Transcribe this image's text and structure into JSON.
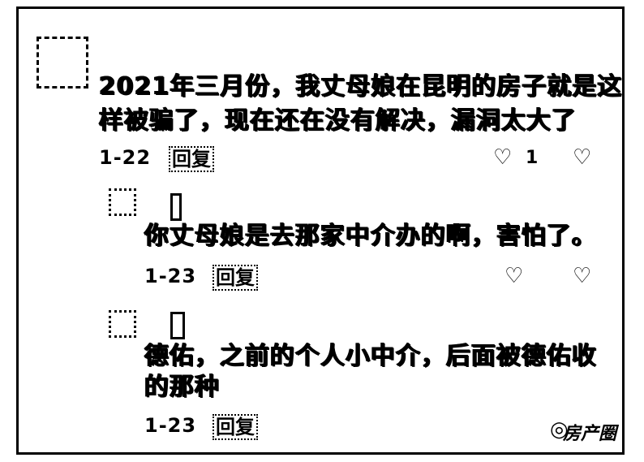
{
  "comments": [
    {
      "text_line1": "2021年三月份，我丈母娘在昆明的房子就是这",
      "text_line2": "样被骗了，现在还在没有解决，漏洞太大了",
      "date": "1-22",
      "reply_label": "回复",
      "like_count": "1"
    },
    {
      "text_line1": "你丈母娘是去那家中介办的啊，害怕了。",
      "date": "1-23",
      "reply_label": "回复"
    },
    {
      "text_line1": "德佑，之前的个人小中介，后面被德佑收",
      "text_line2": "的那种",
      "date": "1-23",
      "reply_label": "回复"
    }
  ],
  "icons": {
    "like": "heart-icon",
    "dislike": "dislike-heart-icon",
    "wechat": "wechat-logo-icon"
  },
  "watermark": {
    "text": "房产圈"
  }
}
